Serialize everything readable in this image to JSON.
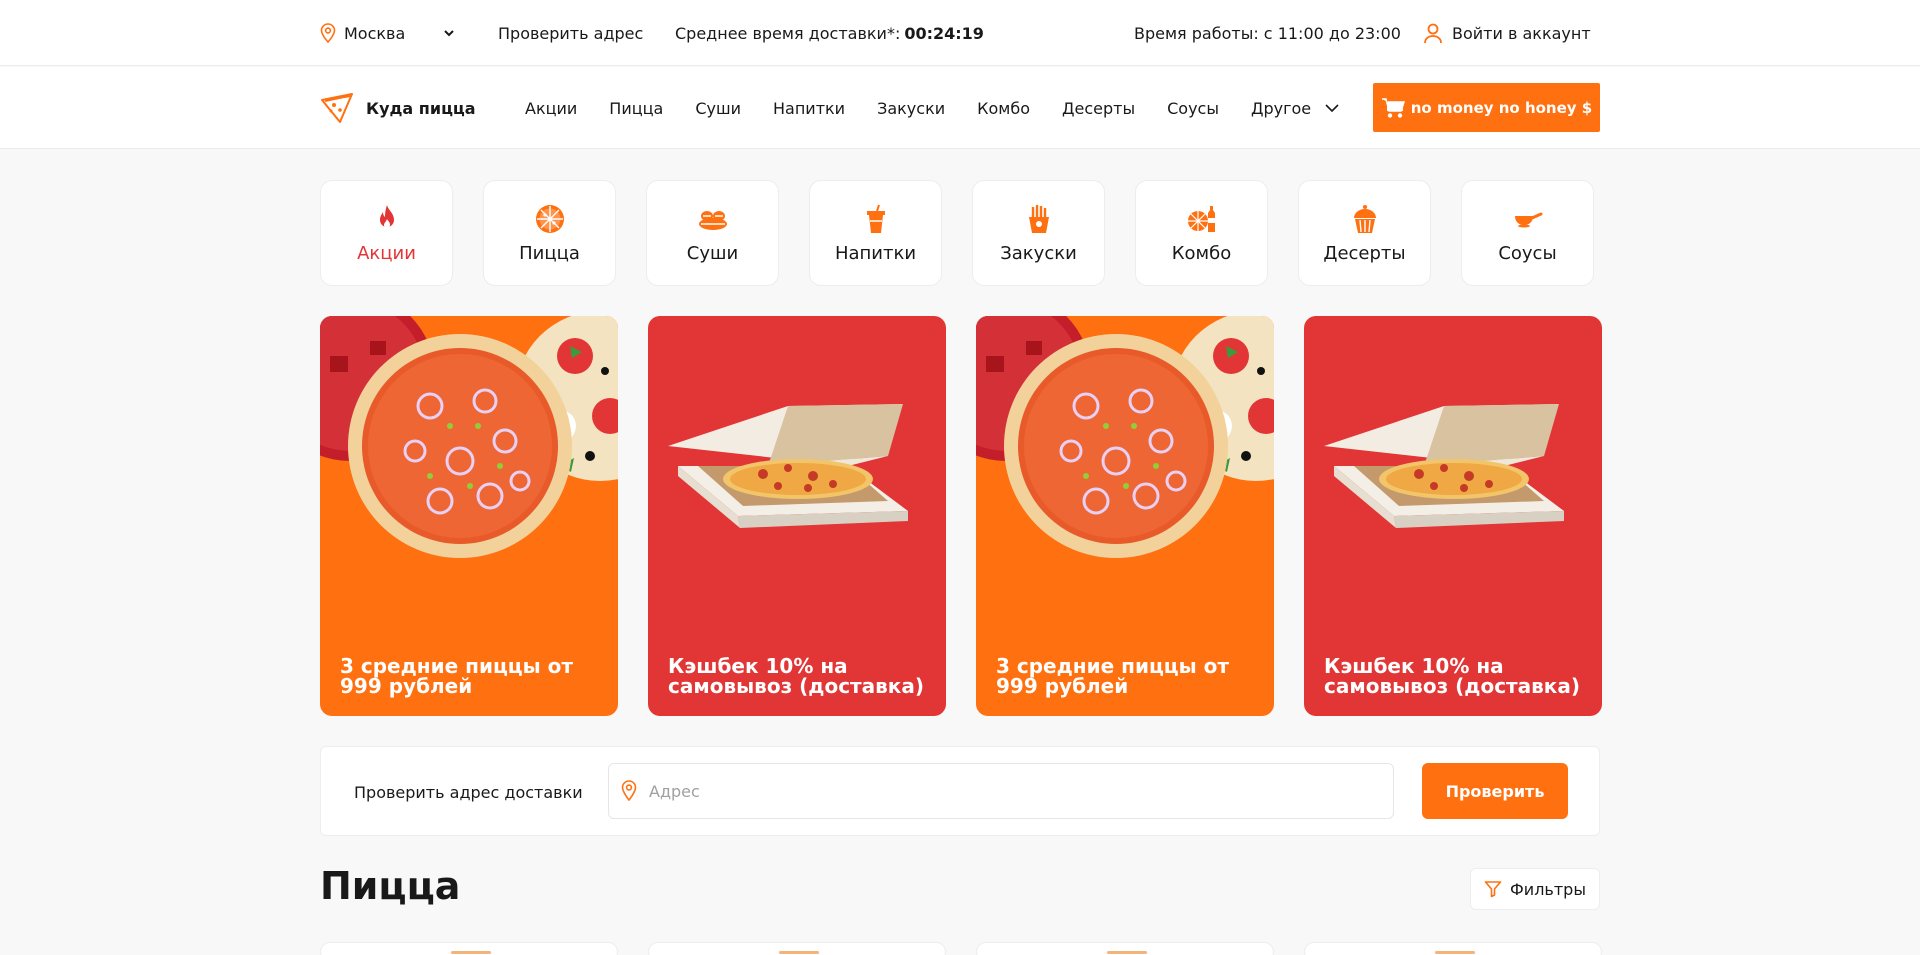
{
  "topbar": {
    "city": "Москва",
    "check_address": "Проверить адрес",
    "delivery_time_label": "Среднее время доставки*:",
    "delivery_time_value": "00:24:19",
    "hours": "Время работы: с 11:00 до 23:00",
    "login": "Войти в аккаунт"
  },
  "header": {
    "logo_text": "Куда пицца",
    "nav": [
      "Акции",
      "Пицца",
      "Суши",
      "Напитки",
      "Закуски",
      "Комбо",
      "Десерты",
      "Соусы"
    ],
    "nav_more": "Другое",
    "cart_label": "no money no honey $"
  },
  "categories": [
    {
      "label": "Акции",
      "icon": "fire-icon",
      "active": true
    },
    {
      "label": "Пицца",
      "icon": "pizza-icon"
    },
    {
      "label": "Суши",
      "icon": "sushi-icon"
    },
    {
      "label": "Напитки",
      "icon": "drink-icon"
    },
    {
      "label": "Закуски",
      "icon": "fries-icon"
    },
    {
      "label": "Комбо",
      "icon": "combo-icon"
    },
    {
      "label": "Десерты",
      "icon": "cupcake-icon"
    },
    {
      "label": "Соусы",
      "icon": "sauce-icon"
    }
  ],
  "promos": [
    {
      "text": "3 средние пиццы от 999 рублей",
      "color": "#ff7010",
      "image": "pizza-image"
    },
    {
      "text": "Кэшбек 10% на самовывоз (доставка)",
      "color": "#e23535",
      "image": "pizza-box-image"
    },
    {
      "text": "3 средние пиццы от 999 рублей",
      "color": "#ff7010",
      "image": "pizza-image"
    },
    {
      "text": "Кэшбек 10% на самовывоз (доставка)",
      "color": "#e23535",
      "image": "pizza-box-image"
    }
  ],
  "address_check": {
    "label": "Проверить адрес доставки",
    "placeholder": "Адрес",
    "button": "Проверить"
  },
  "section": {
    "title": "Пицца",
    "filters": "Фильтры"
  },
  "colors": {
    "accent": "#ff7010",
    "red": "#e23535",
    "background": "#f8f8f8"
  }
}
